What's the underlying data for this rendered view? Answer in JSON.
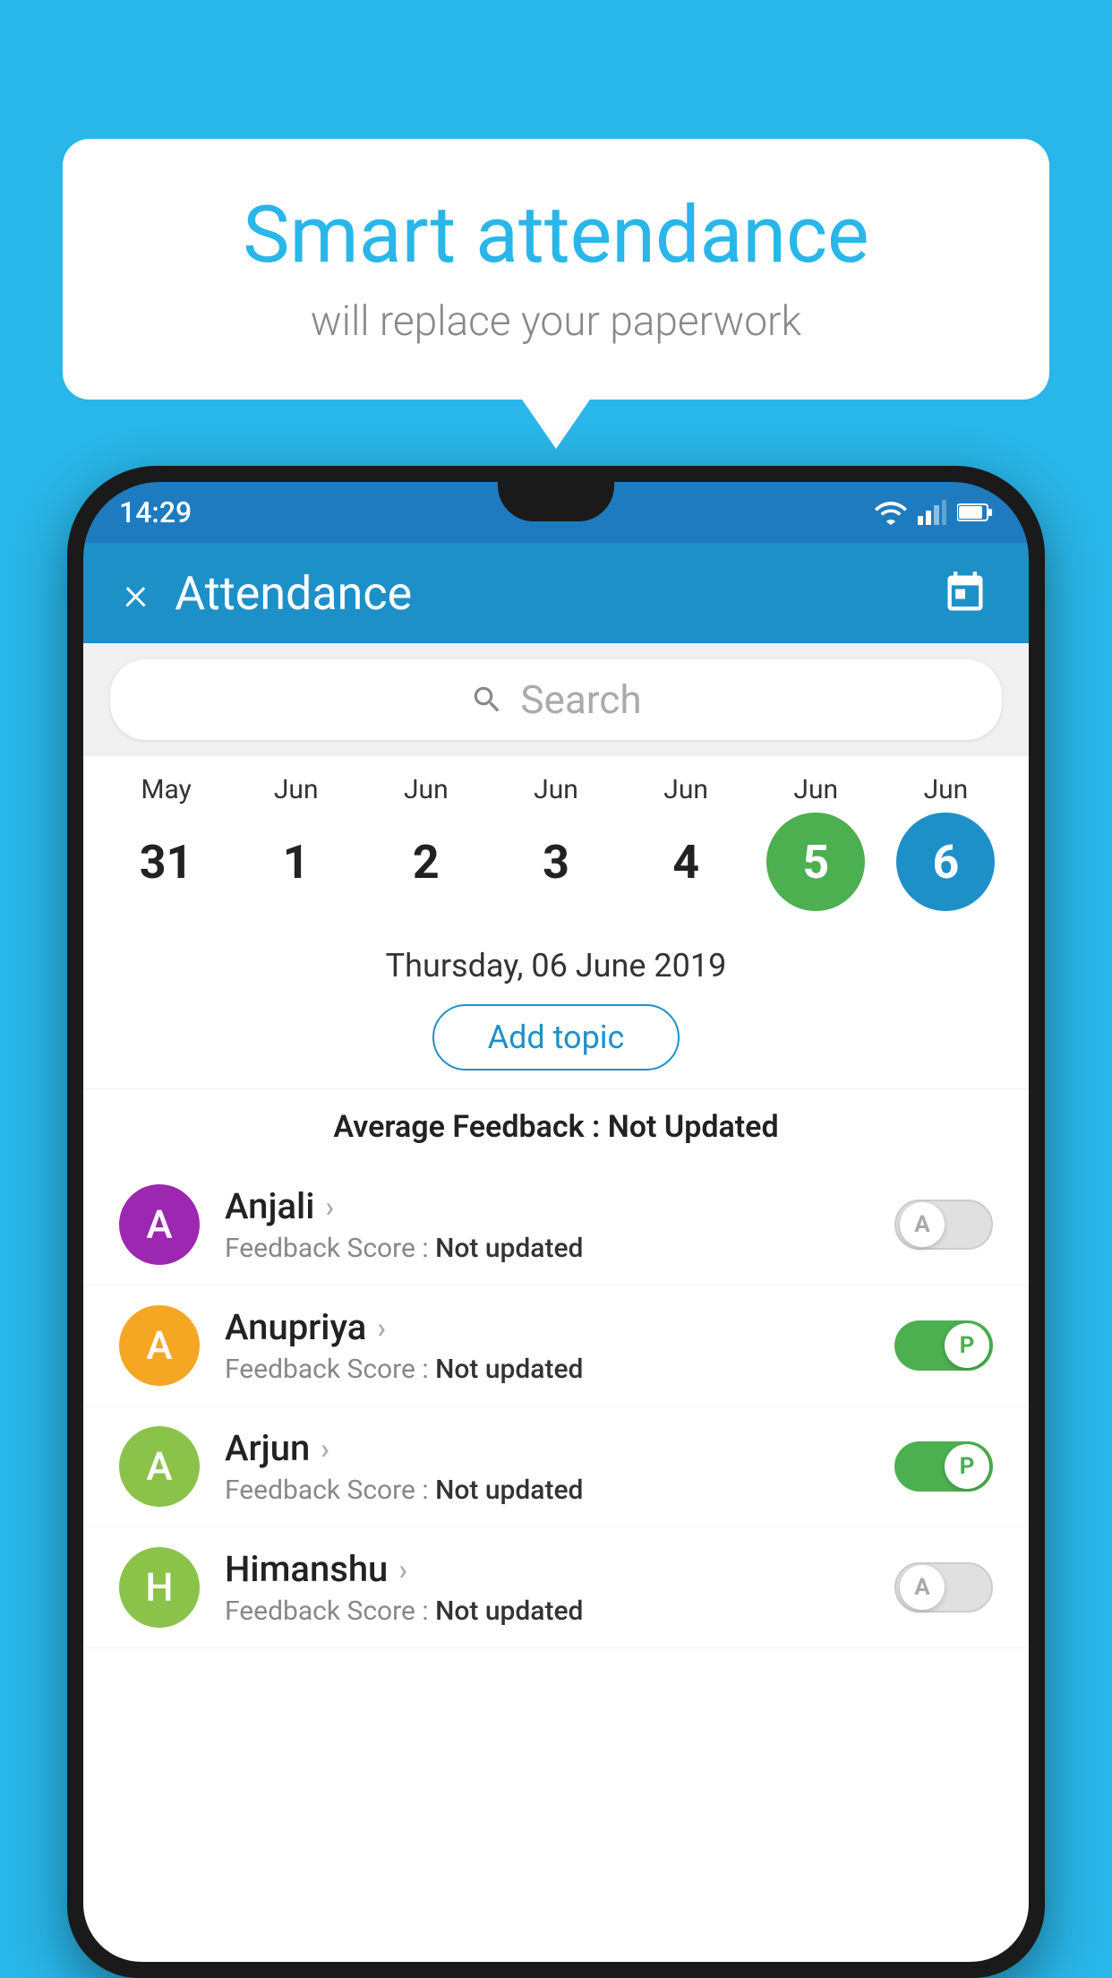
{
  "background_color": "#29b6e8",
  "bubble": {
    "title": "Smart attendance",
    "subtitle": "will replace your paperwork"
  },
  "status_bar": {
    "time": "14:29",
    "wifi_icon": "wifi-icon",
    "signal_icon": "signal-icon",
    "battery_icon": "battery-icon"
  },
  "app_bar": {
    "title": "Attendance",
    "close_label": "×",
    "calendar_icon": "calendar-icon"
  },
  "search": {
    "placeholder": "Search"
  },
  "calendar": {
    "months": [
      "May",
      "Jun",
      "Jun",
      "Jun",
      "Jun",
      "Jun",
      "Jun"
    ],
    "dates": [
      "31",
      "1",
      "2",
      "3",
      "4",
      "5",
      "6"
    ],
    "selected_index": 6,
    "today_index": 5
  },
  "selected_date": {
    "text": "Thursday, 06 June 2019",
    "add_topic_label": "Add topic",
    "feedback_label": "Average Feedback : ",
    "feedback_value": "Not Updated"
  },
  "students": [
    {
      "name": "Anjali",
      "avatar_letter": "A",
      "avatar_color": "#9c27b0",
      "feedback_label": "Feedback Score : ",
      "feedback_value": "Not updated",
      "toggle_state": "off",
      "toggle_letter": "A"
    },
    {
      "name": "Anupriya",
      "avatar_letter": "A",
      "avatar_color": "#f5a623",
      "feedback_label": "Feedback Score : ",
      "feedback_value": "Not updated",
      "toggle_state": "on",
      "toggle_letter": "P"
    },
    {
      "name": "Arjun",
      "avatar_letter": "A",
      "avatar_color": "#8bc34a",
      "feedback_label": "Feedback Score : ",
      "feedback_value": "Not updated",
      "toggle_state": "on",
      "toggle_letter": "P"
    },
    {
      "name": "Himanshu",
      "avatar_letter": "H",
      "avatar_color": "#8bc34a",
      "feedback_label": "Feedback Score : ",
      "feedback_value": "Not updated",
      "toggle_state": "off",
      "toggle_letter": "A"
    }
  ]
}
